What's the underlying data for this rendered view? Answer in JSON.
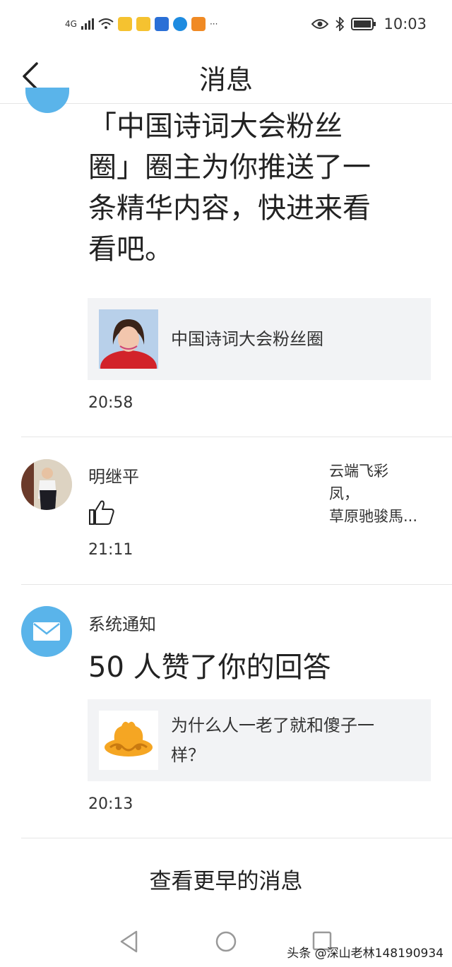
{
  "status_bar": {
    "network": "4G",
    "time": "10:03"
  },
  "header": {
    "title": "消息"
  },
  "messages": [
    {
      "text": "「中国诗词大会粉丝圈」圈主为你推送了一条精华内容，快进来看看吧。",
      "lines": [
        "「中国诗词大会粉丝",
        "圈」圈主为你推送了一",
        "条精华内容，快进来看",
        "看吧。"
      ],
      "card_text": "中国诗词大会粉丝圈",
      "time": "20:58"
    },
    {
      "name": "明继平",
      "quote_lines": [
        "云端飞彩",
        "凤，",
        "草原驰骏馬..."
      ],
      "time": "21:11"
    },
    {
      "name": "系统通知",
      "headline": "50 人赞了你的回答",
      "card_lines": [
        "为什么人一老了就和傻子一",
        "样？"
      ],
      "time": "20:13"
    }
  ],
  "footer": {
    "more_label": "查看更早的消息"
  },
  "watermark": "头条 @深山老林148190934",
  "colors": {
    "accent_blue": "#5ab4ea",
    "card_bg": "#f2f3f5",
    "divider": "#e6e6e6"
  }
}
